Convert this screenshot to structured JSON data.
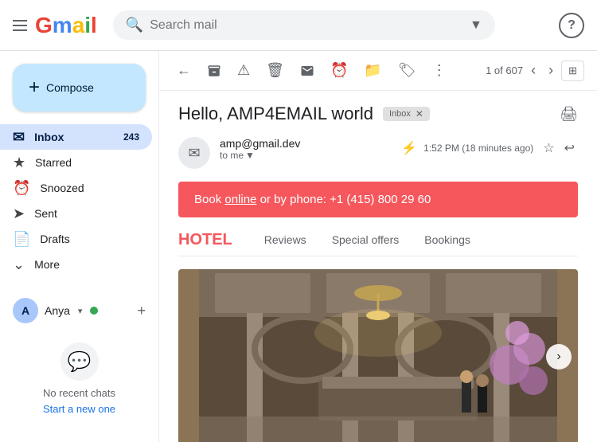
{
  "app": {
    "title": "Gmail",
    "logo_text": "Gmail"
  },
  "search": {
    "placeholder": "Search mail",
    "value": ""
  },
  "compose": {
    "label": "Compose",
    "plus_icon": "+"
  },
  "nav": {
    "items": [
      {
        "id": "inbox",
        "label": "Inbox",
        "icon": "inbox",
        "badge": "243",
        "active": true
      },
      {
        "id": "starred",
        "label": "Starred",
        "icon": "star",
        "badge": "",
        "active": false
      },
      {
        "id": "snoozed",
        "label": "Snoozed",
        "icon": "snooze",
        "badge": "",
        "active": false
      },
      {
        "id": "sent",
        "label": "Sent",
        "icon": "send",
        "badge": "",
        "active": false
      },
      {
        "id": "drafts",
        "label": "Drafts",
        "icon": "drafts",
        "badge": "",
        "active": false
      },
      {
        "id": "more",
        "label": "More",
        "icon": "expand",
        "badge": "",
        "active": false
      }
    ]
  },
  "chat": {
    "user": {
      "name": "Anya",
      "initials": "A",
      "avatar_color": "#a8c7fa"
    },
    "no_chats": "No recent chats",
    "start_link": "Start a new one"
  },
  "toolbar": {
    "back_title": "Back",
    "archive_title": "Archive",
    "report_title": "Report spam",
    "delete_title": "Delete",
    "mark_title": "Mark as unread",
    "snooze_title": "Snooze",
    "move_title": "Move to",
    "labels_title": "Labels",
    "more_title": "More",
    "pagination": "1 of 607",
    "prev_title": "Older",
    "next_title": "Newer",
    "grid_label": "⊞"
  },
  "email": {
    "subject": "Hello, AMP4EMAIL world",
    "inbox_badge": "Inbox",
    "sender_name": "amp@gmail.dev",
    "to_me": "to me",
    "timestamp": "1:52 PM (18 minutes ago)",
    "lightning_icon": "⚡",
    "star_icon": "☆",
    "reply_icon": "↩",
    "book_text": "Book ",
    "book_link": "online",
    "book_rest": " or by phone: +1 (415) 800 29 60",
    "hotel_label": "HOTEL",
    "tabs": [
      "Reviews",
      "Special offers",
      "Bookings"
    ],
    "image_next": "›"
  }
}
